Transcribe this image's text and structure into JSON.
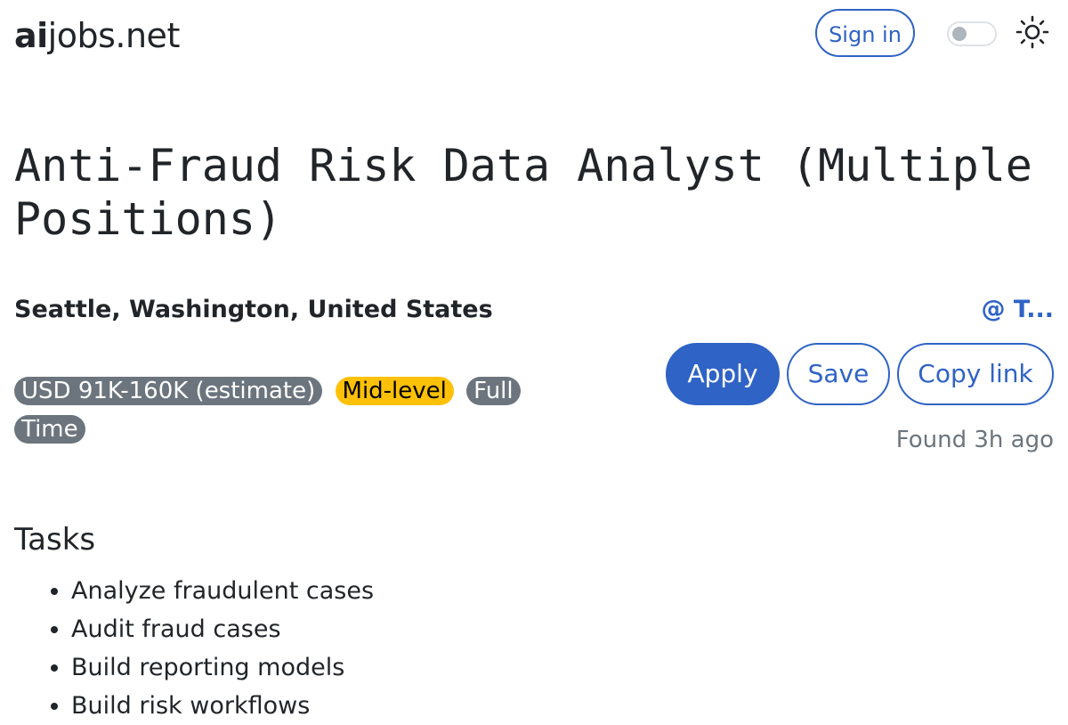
{
  "site": {
    "brand_bold": "ai",
    "brand_rest": "jobs.net"
  },
  "header": {
    "sign_in": "Sign in",
    "theme_toggle": "off",
    "theme_icon": "sun-icon"
  },
  "job": {
    "title": "Anti-Fraud Risk Data Analyst (Multiple Positions)",
    "location": "Seattle, Washington, United States",
    "company": "@ T...",
    "badges": {
      "salary": "USD 91K-160K (estimate)",
      "level": "Mid-level",
      "type": "Full Time"
    },
    "found": "Found 3h ago"
  },
  "actions": {
    "apply": "Apply",
    "save": "Save",
    "copy_link": "Copy link"
  },
  "tasks": {
    "heading": "Tasks",
    "items": [
      "Analyze fraudulent cases",
      "Audit fraud cases",
      "Build reporting models",
      "Build risk workflows"
    ]
  },
  "colors": {
    "accent": "#2f63c5",
    "badge_gray": "#6c757d",
    "badge_yellow": "#ffc107"
  }
}
